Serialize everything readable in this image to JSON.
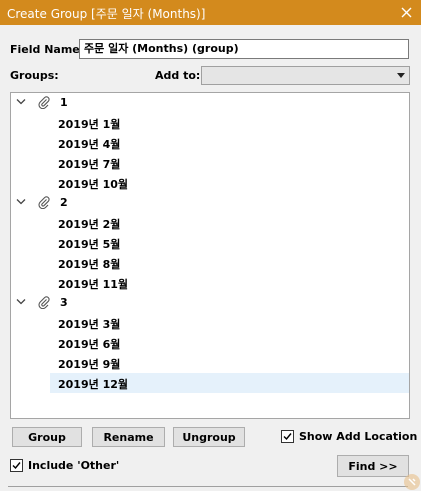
{
  "window": {
    "title": "Create Group [주문 일자 (Months)]"
  },
  "form": {
    "field_name_label": "Field Name:",
    "field_name_value": "주문 일자 (Months) (group)",
    "groups_label": "Groups:",
    "add_to_label": "Add to:",
    "add_to_value": ""
  },
  "groups": [
    {
      "name": "1",
      "members": [
        "2019년 1월",
        "2019년 4월",
        "2019년 7월",
        "2019년 10월"
      ]
    },
    {
      "name": "2",
      "members": [
        "2019년 2월",
        "2019년 5월",
        "2019년 8월",
        "2019년 11월"
      ]
    },
    {
      "name": "3",
      "members": [
        "2019년 3월",
        "2019년 6월",
        "2019년 9월",
        "2019년 12월"
      ]
    }
  ],
  "selected_member": "2019년 12월",
  "buttons": {
    "group": "Group",
    "rename": "Rename",
    "ungroup": "Ungroup",
    "find": "Find >>"
  },
  "checkboxes": {
    "show_add_location": {
      "label": "Show Add Location",
      "checked": true
    },
    "include_other": {
      "label": "Include 'Other'",
      "checked": true
    }
  },
  "colors": {
    "titlebar": "#d38a1d",
    "selection": "#e5f1fb"
  },
  "icons": {
    "close": "close-icon",
    "expand": "chevron-down-icon",
    "group": "paperclip-icon",
    "dropdown": "chevron-down-icon",
    "check": "checkmark-icon"
  }
}
